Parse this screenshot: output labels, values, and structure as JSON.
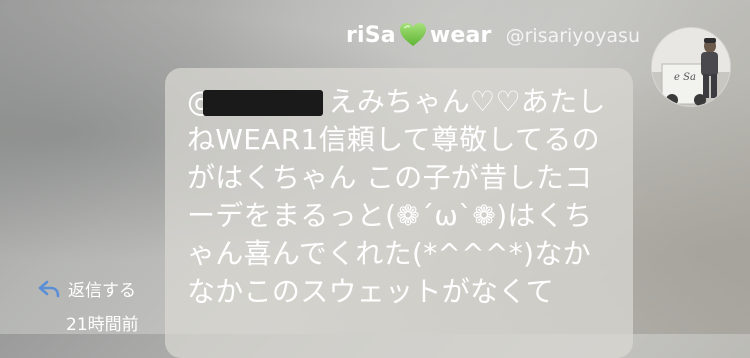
{
  "header": {
    "name_part1": "riSa",
    "name_part2": "wear",
    "username": "@risariyoyasu"
  },
  "icons": {
    "heart": "green-heart-icon",
    "reply": "reply-arrow-icon"
  },
  "colors": {
    "heart": "#7ec94a",
    "reply_icon": "#5a8fd6",
    "text": "#ffffff"
  },
  "message": {
    "mention_prefix": "@",
    "body": "えみちゃん♡♡あたしねWEAR1信頼して尊敬してるのがはくちゃん この子が昔したコーデをまるっと(❁´ω`❁)はくちゃん喜んでくれた(*^^^*)なかなかこのスウェットがなくて"
  },
  "actions": {
    "reply_label": "返信する"
  },
  "meta": {
    "timestamp": "21時間前"
  }
}
